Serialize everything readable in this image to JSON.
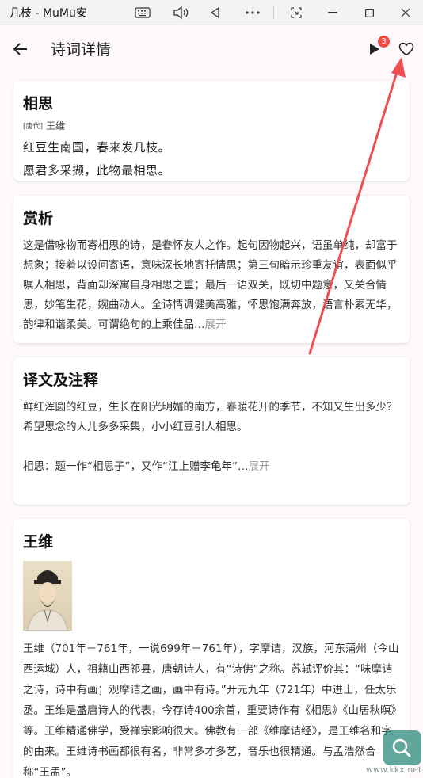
{
  "window": {
    "title": "几枝 - MuMu安",
    "controls": [
      "keyboard-icon",
      "volume-icon",
      "back-triangle-icon",
      "more-icon",
      "screenshot-icon",
      "minimize-icon",
      "maximize-icon",
      "close-icon"
    ]
  },
  "header": {
    "title": "诗词详情",
    "badge_count": "3"
  },
  "poem": {
    "title": "相思",
    "dynasty": "[唐代]",
    "author": "王维",
    "lines": [
      "红豆生南国，春来发几枝。",
      "愿君多采撷，此物最相思。"
    ]
  },
  "appreciation": {
    "heading": "赏析",
    "text": "这是借咏物而寄相思的诗，是眷怀友人之作。起句因物起兴，语虽单纯，却富于想象；接着以设问寄语，意味深长地寄托情思；第三句暗示珍重友谊，表面似乎嘱人相思，背面却深寓自身相思之重；最后一语双关，既切中题意，又关合情思，妙笔生花，婉曲动人。全诗情调健美高雅，怀思饱满奔放，语言朴素无华，韵律和谐柔美。可谓绝句的上乘佳品…",
    "expand": "展开"
  },
  "translation": {
    "heading": "译文及注释",
    "line1": "鲜红浑圆的红豆，生长在阳光明媚的南方，春暖花开的季节，不知又生出多少？",
    "line2": "希望思念的人儿多多采集，小小红豆引人相思。",
    "note": "相思：题一作“相思子”，又作“江上赠李龟年”…",
    "expand": "展开"
  },
  "author_card": {
    "heading": "王维",
    "bio": "王维（701年－761年，一说699年－761年），字摩诘，汉族，河东蒲州（今山西运城）人，祖籍山西祁县，唐朝诗人，有“诗佛”之称。苏轼评价其：“味摩诘之诗，诗中有画；观摩诘之画，画中有诗。”开元九年（721年）中进士，任太乐丞。王维是盛唐诗人的代表，今存诗400余首，重要诗作有《相思》《山居秋暝》等。王维精通佛学，受禅宗影响很大。佛教有一部《维摩诘经》，是王维名和字的由来。王维诗书画都很有名，非常多才多艺，音乐也很精通。与孟浩然合称“王孟”。"
  },
  "watermark": {
    "text": "www.kkx.net"
  },
  "colors": {
    "badge": "#f04a43",
    "arrow": "#ef4f52",
    "background": "#fcf8fc"
  }
}
